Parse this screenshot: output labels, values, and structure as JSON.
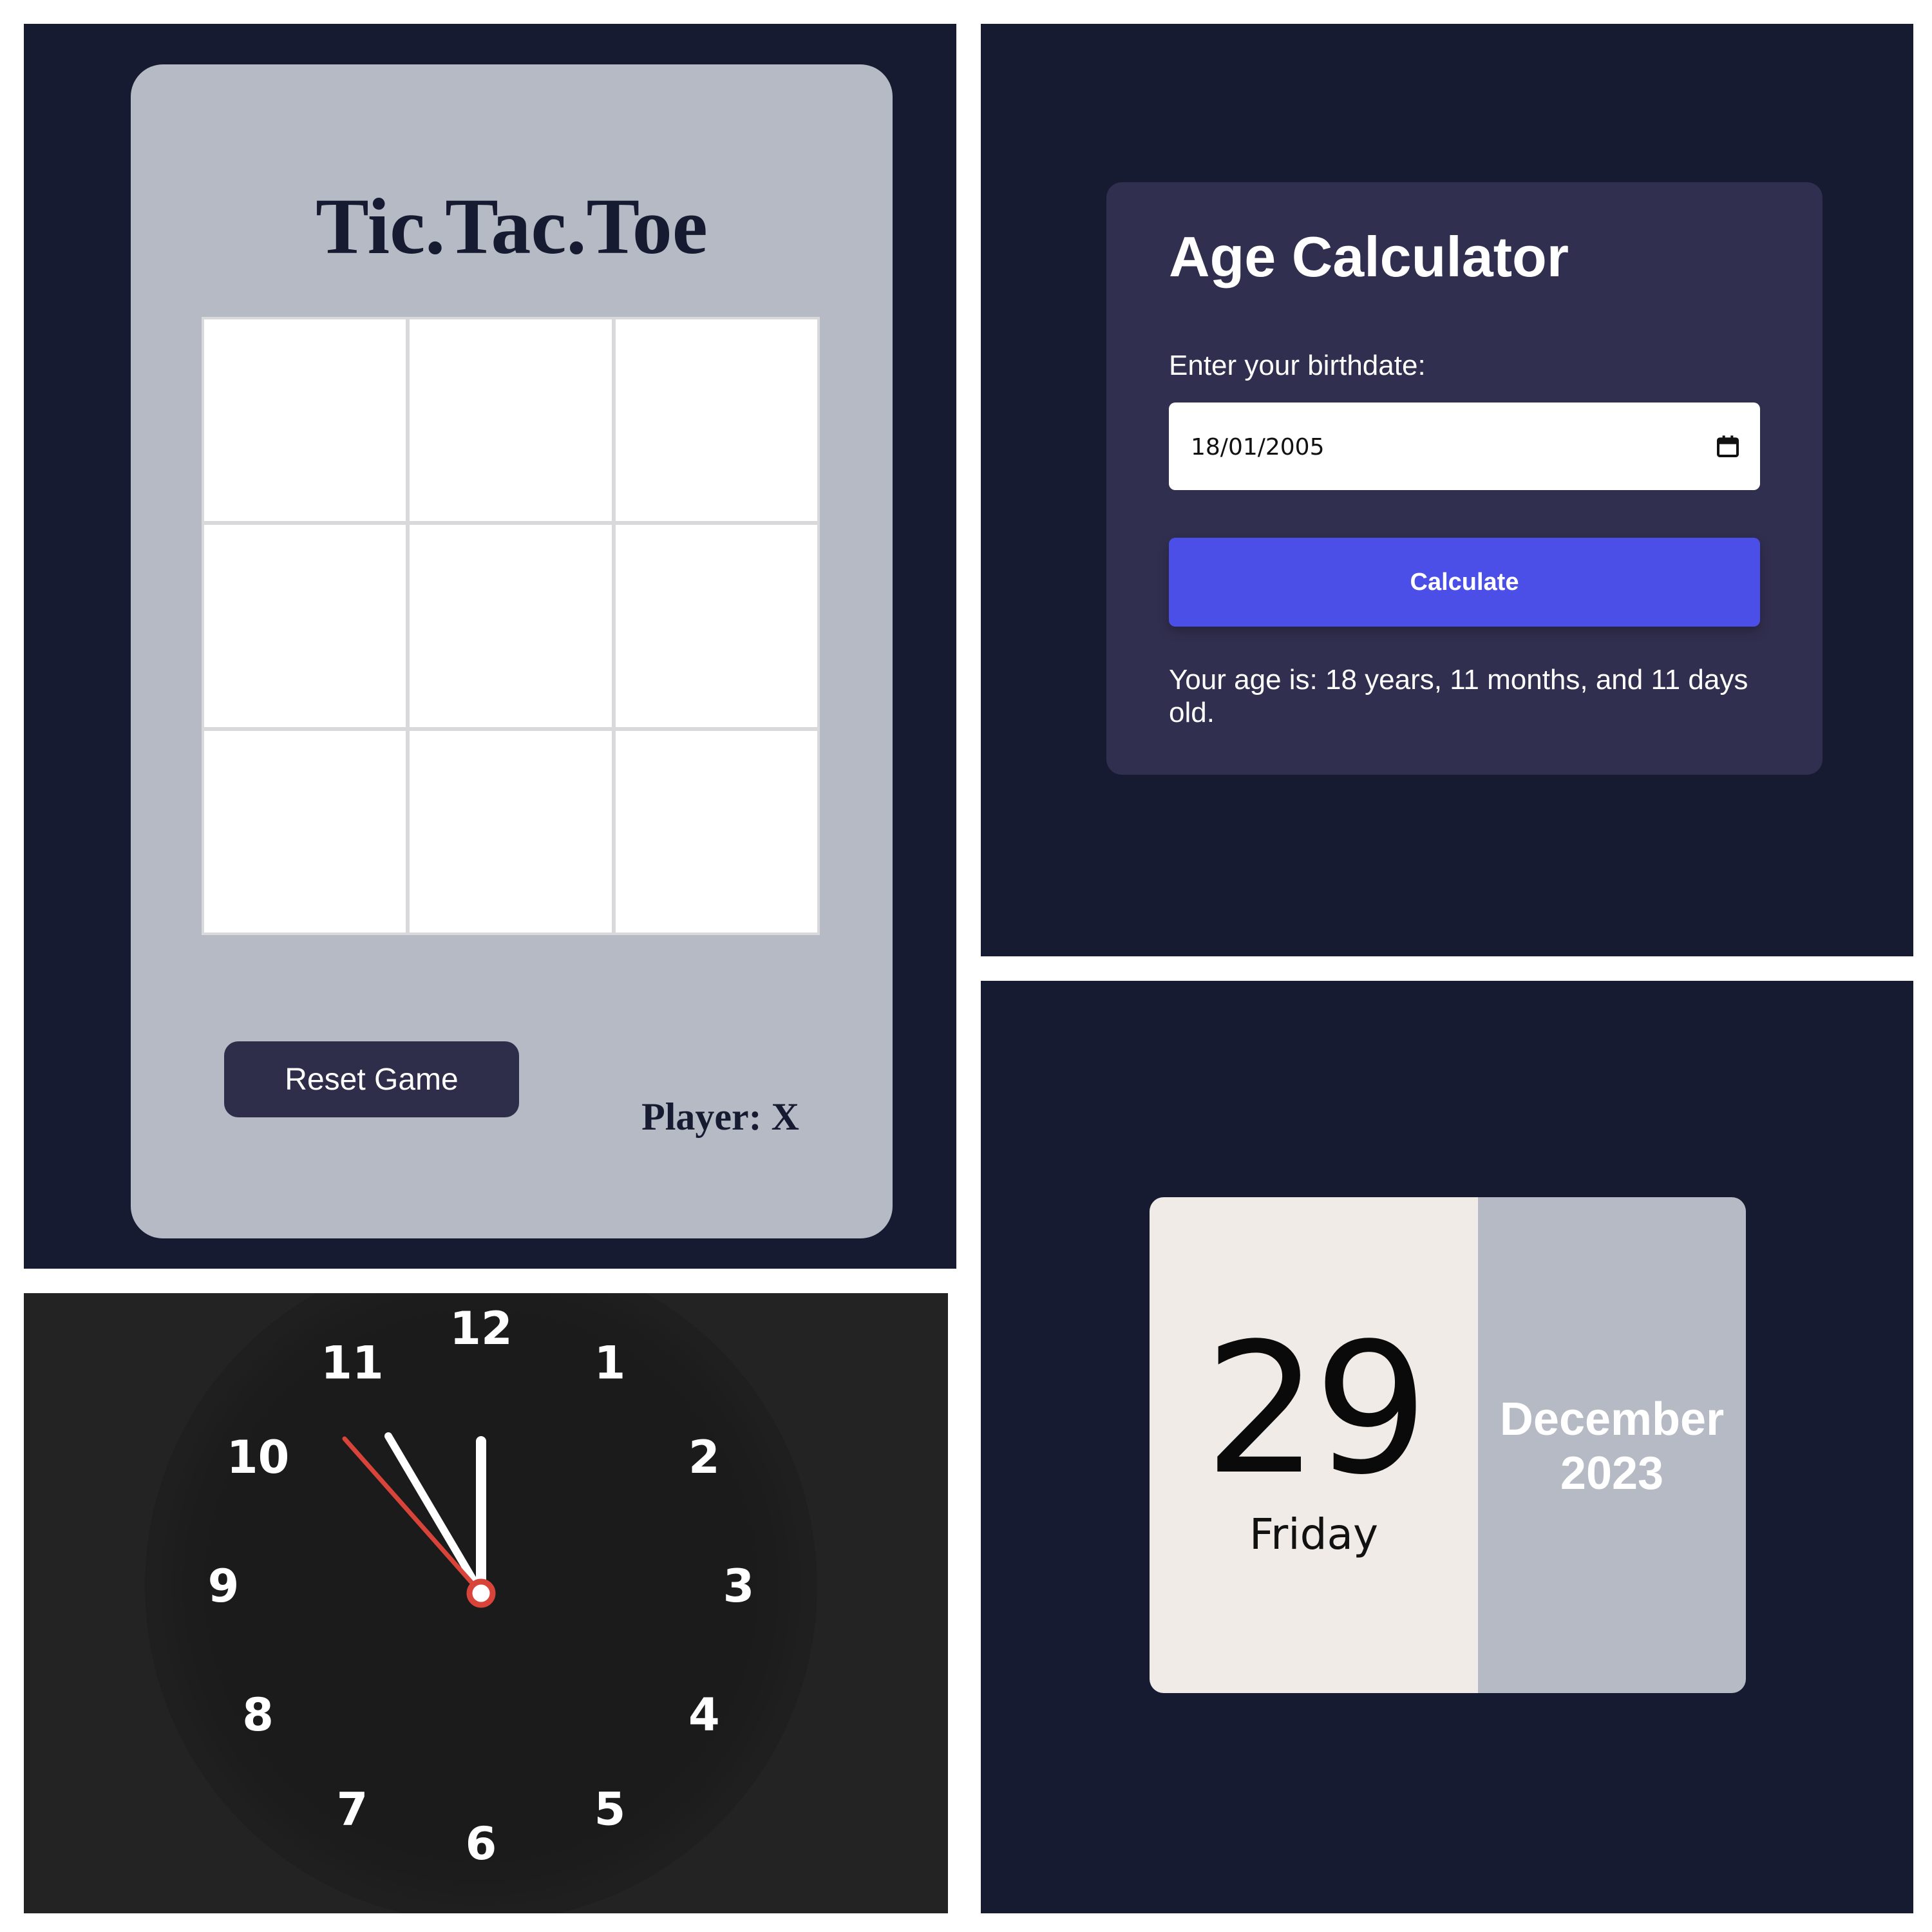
{
  "tictactoe": {
    "title": "Tic.Tac.Toe",
    "cells": [
      "",
      "",
      "",
      "",
      "",
      "",
      "",
      "",
      ""
    ],
    "reset_label": "Reset Game",
    "player_text": "Player: X"
  },
  "age_calculator": {
    "title": "Age Calculator",
    "label": "Enter your birthdate:",
    "birthdate_value": "18/01/2005",
    "calculate_label": "Calculate",
    "result_text": "Your age is: 18 years, 11 months, and 11 days old.",
    "accent_color": "#4b4fe8"
  },
  "clock": {
    "numbers": [
      "12",
      "1",
      "2",
      "3",
      "4",
      "5",
      "6",
      "7",
      "8",
      "9",
      "10",
      "11"
    ],
    "time": {
      "hour": 11,
      "minute": 57,
      "second": 53
    },
    "second_hand_color": "#d9443a"
  },
  "date_card": {
    "day": "29",
    "weekday": "Friday",
    "month": "December",
    "year": "2023"
  }
}
